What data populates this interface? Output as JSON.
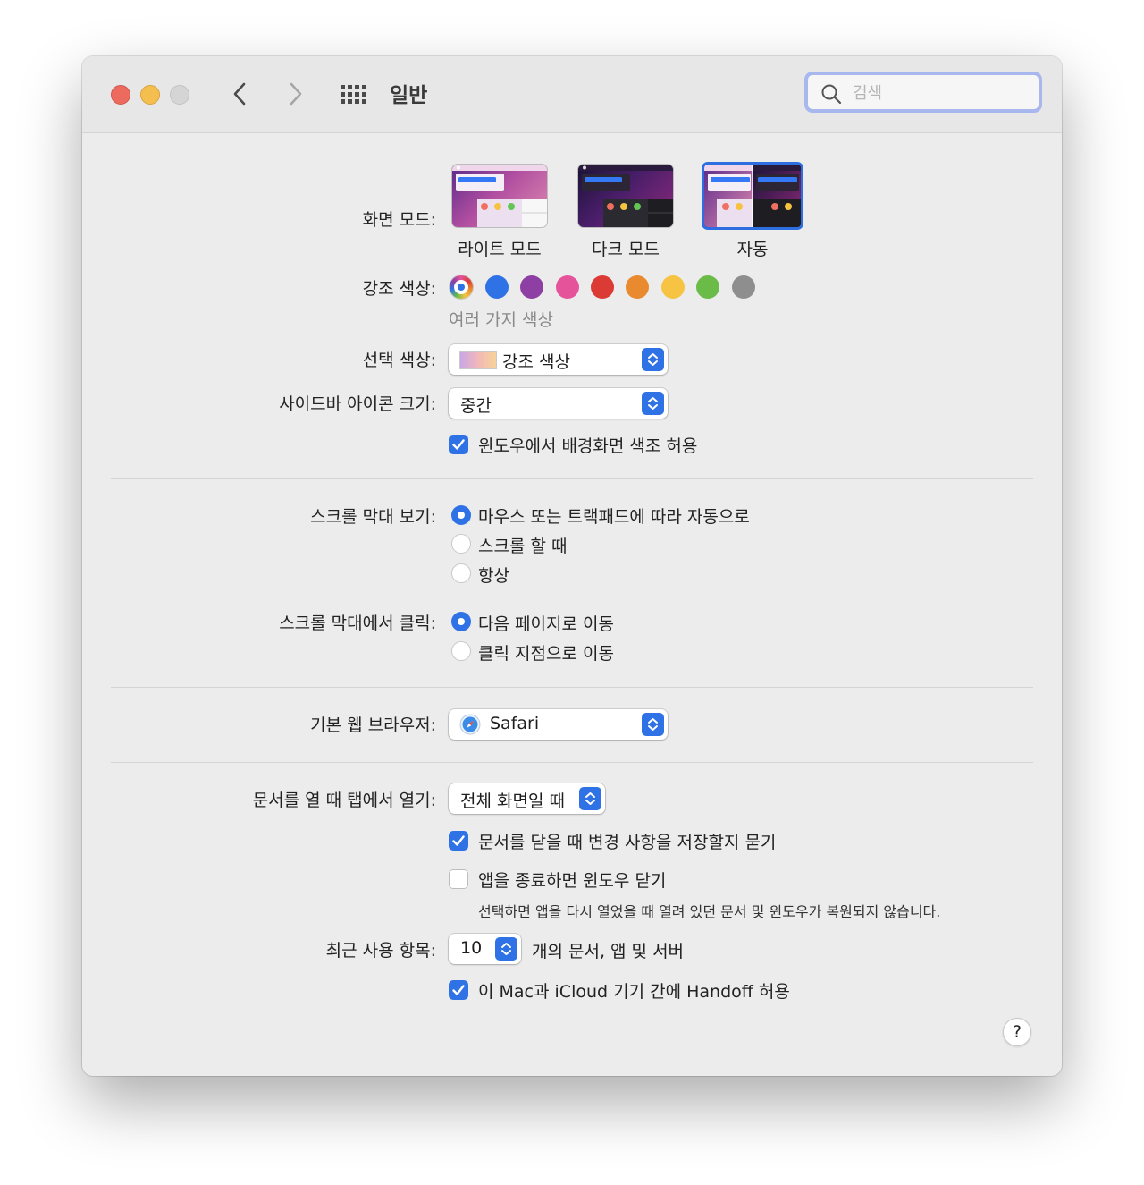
{
  "window": {
    "title": "일반"
  },
  "search": {
    "placeholder": "검색"
  },
  "appearance": {
    "label": "화면 모드:",
    "options": [
      {
        "label": "라이트 모드",
        "selected": false
      },
      {
        "label": "다크 모드",
        "selected": false
      },
      {
        "label": "자동",
        "selected": true
      }
    ]
  },
  "accent": {
    "label": "강조 색상:",
    "selected_caption": "여러 가지 색상",
    "colors": [
      "multicolor",
      "#2f72e5",
      "#8e3fa3",
      "#e5549b",
      "#dc3a35",
      "#ea8a2e",
      "#f6c442",
      "#6bbb48",
      "#8e8e8e"
    ]
  },
  "highlight": {
    "label": "선택 색상:",
    "value": "강조 색상"
  },
  "sidebar_icon_size": {
    "label": "사이드바 아이콘 크기:",
    "value": "중간"
  },
  "wallpaper_tinting": {
    "label": "윈도우에서 배경화면 색조 허용",
    "checked": true
  },
  "show_scroll_bars": {
    "label": "스크롤 막대 보기:",
    "options": [
      {
        "label": "마우스 또는 트랙패드에 따라 자동으로",
        "selected": true
      },
      {
        "label": "스크롤 할 때",
        "selected": false
      },
      {
        "label": "항상",
        "selected": false
      }
    ]
  },
  "click_scroll_bar": {
    "label": "스크롤 막대에서 클릭:",
    "options": [
      {
        "label": "다음 페이지로 이동",
        "selected": true
      },
      {
        "label": "클릭 지점으로 이동",
        "selected": false
      }
    ]
  },
  "default_browser": {
    "label": "기본 웹 브라우저:",
    "value": "Safari"
  },
  "prefer_tabs": {
    "label": "문서를 열 때 탭에서 열기:",
    "value": "전체 화면일 때"
  },
  "ask_keep_changes": {
    "label": "문서를 닫을 때 변경 사항을 저장할지 묻기",
    "checked": true
  },
  "close_windows": {
    "label": "앱을 종료하면 윈도우 닫기",
    "checked": false,
    "note": "선택하면 앱을 다시 열었을 때 열려 있던 문서 및 윈도우가 복원되지 않습니다."
  },
  "recent_items": {
    "label": "최근 사용 항목:",
    "value": "10",
    "suffix": "개의 문서, 앱 및 서버"
  },
  "handoff": {
    "label": "이 Mac과 iCloud 기기 간에 Handoff 허용",
    "checked": true
  },
  "help": {
    "label": "?"
  }
}
